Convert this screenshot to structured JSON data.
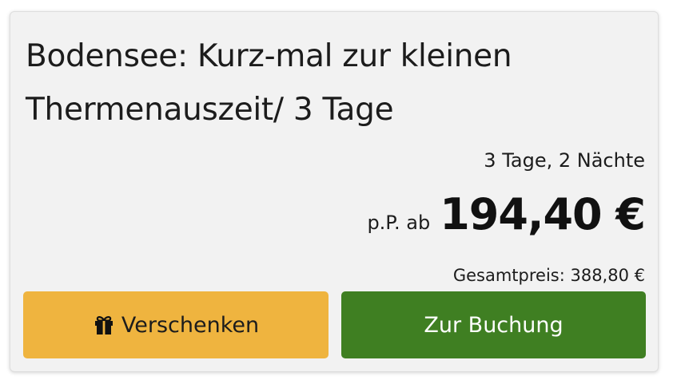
{
  "offer": {
    "title": "Bodensee: Kurz-mal zur kleinen Thermenauszeit/ 3 Tage",
    "duration": "3 Tage, 2 Nächte",
    "price_prefix": "p.P. ab",
    "price": "194,40 €",
    "total": "Gesamtpreis: 388,80 €"
  },
  "actions": {
    "gift_label": "Verschenken",
    "gift_icon": "gift-icon",
    "book_label": "Zur Buchung"
  },
  "colors": {
    "card_background": "#f2f2f2",
    "gift_button": "#efb43f",
    "book_button": "#3f7f22",
    "text": "#1c1c1c"
  }
}
